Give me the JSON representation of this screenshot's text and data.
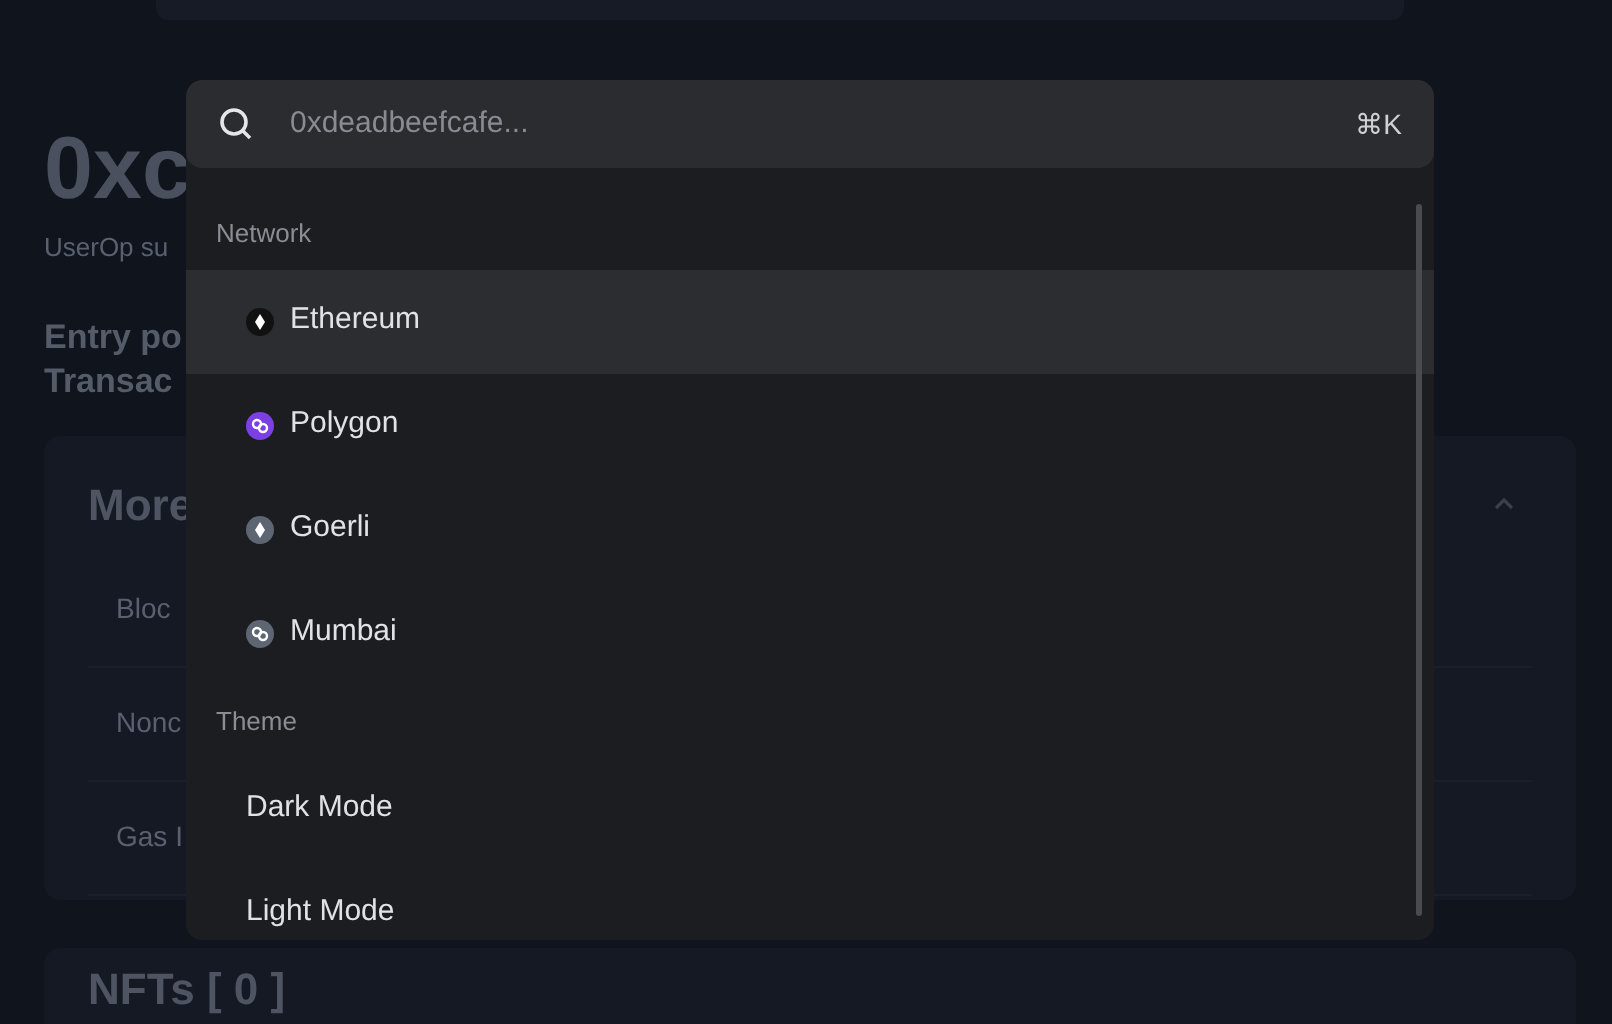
{
  "page": {
    "heading": "0xc",
    "subtitle": "UserOp su",
    "entry_point_label": "Entry po",
    "transaction_label": "Transac",
    "details_card": {
      "title": "More",
      "expanded": true,
      "rows": [
        "Bloc",
        "Nonc",
        "Gas I"
      ]
    },
    "nfts_card": {
      "title": "NFTs [ 0 ]"
    }
  },
  "palette": {
    "search": {
      "placeholder": "0xdeadbeefcafe...",
      "shortcut": "⌘K"
    },
    "sections": [
      {
        "title": "Network",
        "items": [
          {
            "label": "Ethereum",
            "kind": "ethereum",
            "color": "#111111",
            "selected": true
          },
          {
            "label": "Polygon",
            "kind": "polygon",
            "color": "#7b3fe4",
            "selected": false
          },
          {
            "label": "Goerli",
            "kind": "ethereum",
            "color": "#5e6573",
            "selected": false
          },
          {
            "label": "Mumbai",
            "kind": "polygon",
            "color": "#5e6573",
            "selected": false
          }
        ]
      },
      {
        "title": "Theme",
        "items": [
          {
            "label": "Dark Mode",
            "kind": "plain",
            "selected": false
          },
          {
            "label": "Light Mode",
            "kind": "plain",
            "selected": false
          }
        ]
      }
    ]
  }
}
